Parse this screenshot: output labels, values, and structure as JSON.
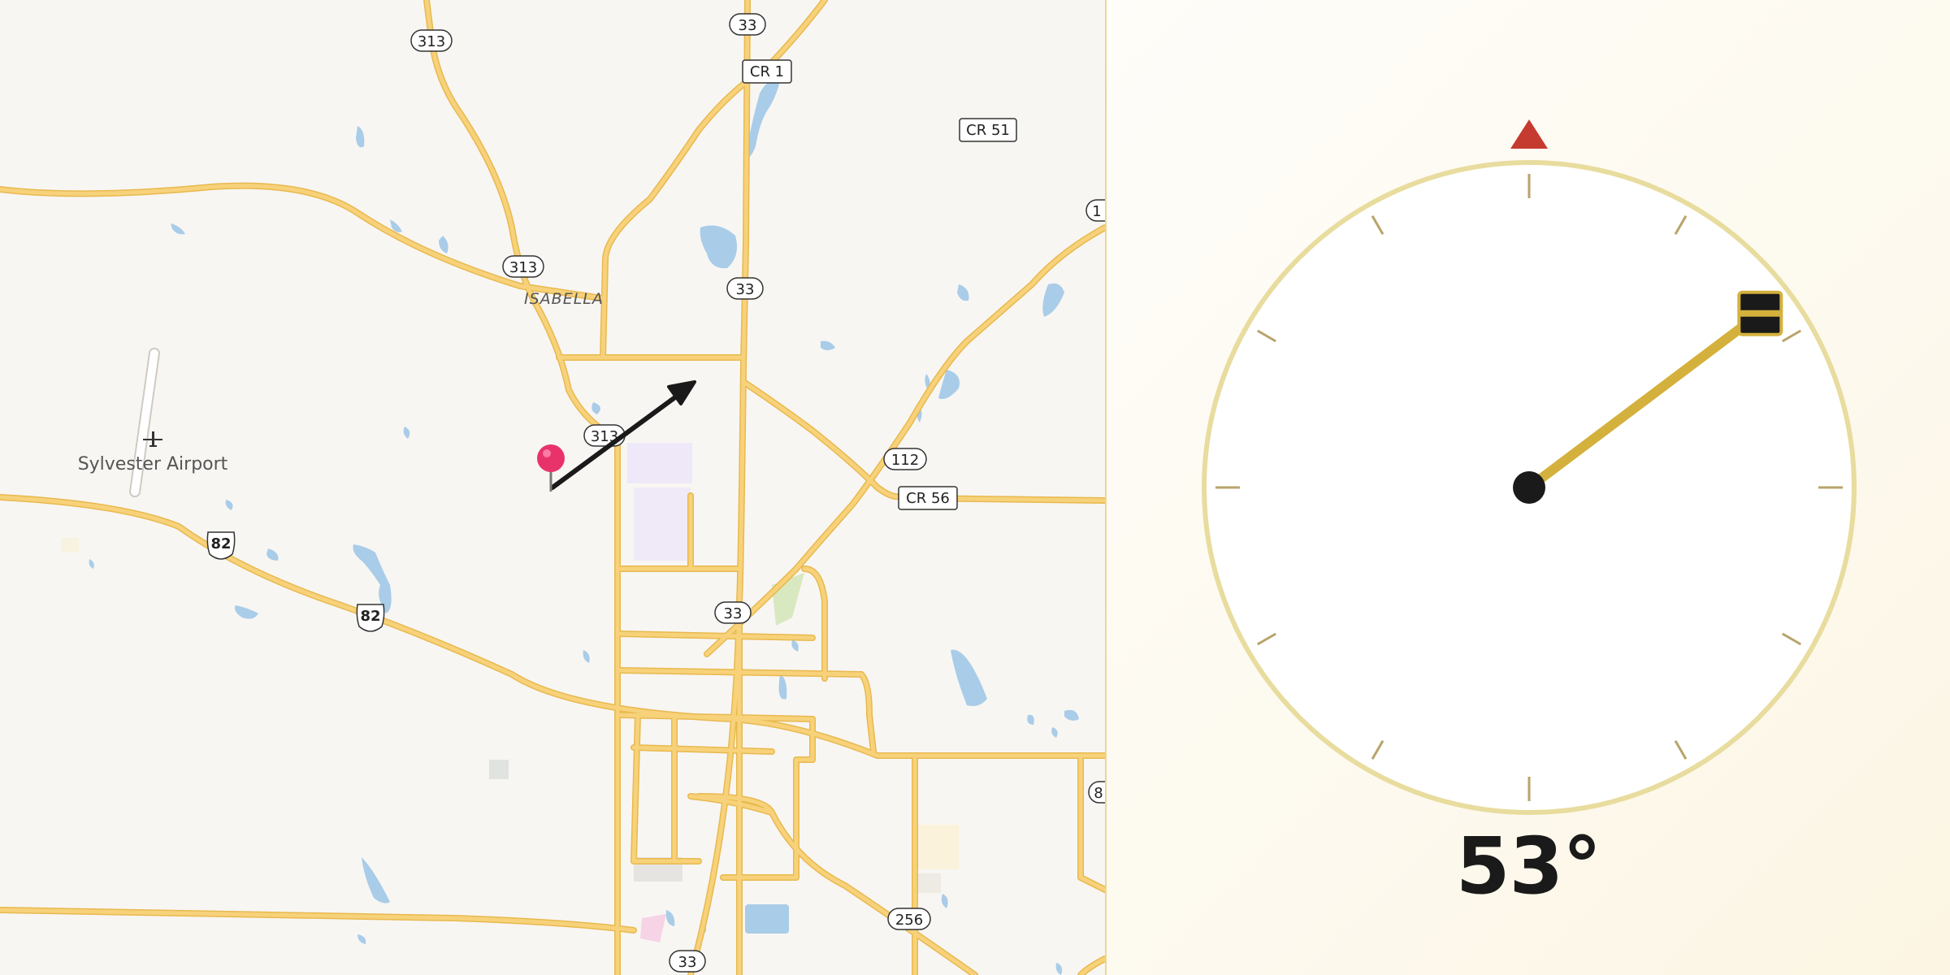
{
  "map": {
    "place_labels": {
      "isabella": "ISABELLA",
      "airport": "Sylvester Airport"
    },
    "shields": {
      "r313_a": "313",
      "r313_b": "313",
      "r313_c": "313",
      "r33_a": "33",
      "r33_b": "33",
      "r33_c": "33",
      "r33_d": "33",
      "cr1": "CR 1",
      "cr51": "CR 51",
      "r112": "112",
      "cr56": "CR 56",
      "us82_a": "82",
      "us82_b": "82",
      "r256": "256",
      "edge_top": "1",
      "edge_right": "8"
    },
    "colors": {
      "background": "#f8f6f3",
      "road": "#f7d27a",
      "road_casing": "#e8b94f",
      "water": "#a9cce8",
      "park": "#d8e8c0",
      "pin": "#e8336a",
      "direction_arrow": "#1a1a1a"
    }
  },
  "compass": {
    "heading_deg": 53,
    "heading_text": "53°",
    "north_marker_color": "#c63b2f",
    "needle_color": "#d4b13c",
    "ring_color": "#e8dc9e"
  }
}
